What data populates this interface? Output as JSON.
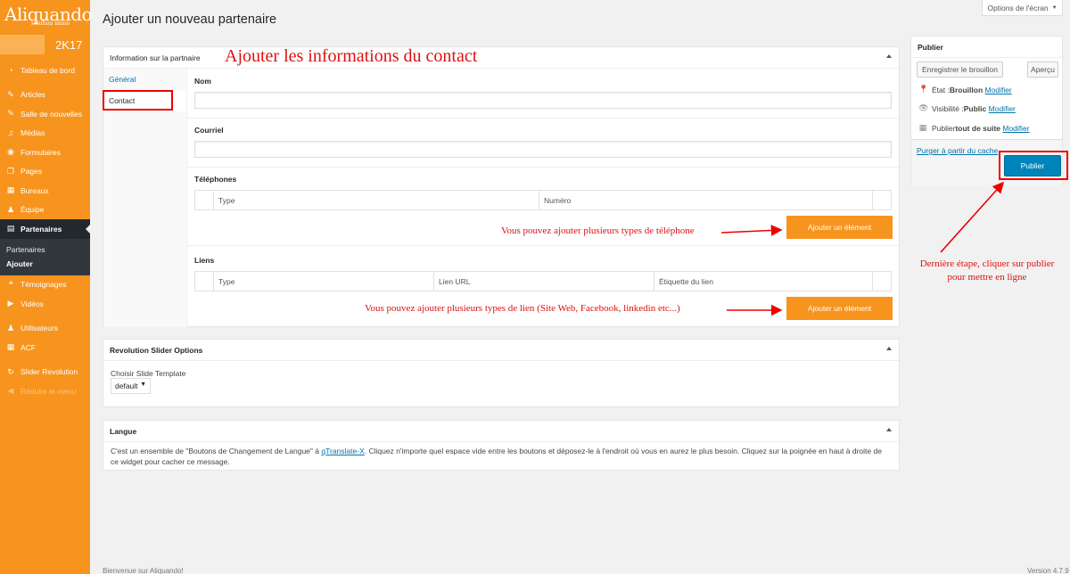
{
  "brand": {
    "logo_text": "Aliquando",
    "logo_sub": "solution immo",
    "year_badge": "2K17"
  },
  "sidebar": {
    "items": [
      {
        "label": "Tableau de bord",
        "icon": "dashboard-icon"
      },
      {
        "label": "Articles",
        "icon": "pin-icon"
      },
      {
        "label": "Salle de nouvelles",
        "icon": "pin-icon"
      },
      {
        "label": "Médias",
        "icon": "media-icon"
      },
      {
        "label": "Formulaires",
        "icon": "forms-icon"
      },
      {
        "label": "Pages",
        "icon": "pages-icon"
      },
      {
        "label": "Bureaux",
        "icon": "building-icon"
      },
      {
        "label": "Équipe",
        "icon": "team-icon"
      },
      {
        "label": "Partenaires",
        "icon": "id-card-icon"
      },
      {
        "label": "Témoignages",
        "icon": "quote-icon"
      },
      {
        "label": "Vidéos",
        "icon": "video-icon"
      },
      {
        "label": "Utilisateurs",
        "icon": "users-icon"
      },
      {
        "label": "ACF",
        "icon": "grid-icon"
      },
      {
        "label": "Slider Revolution",
        "icon": "refresh-icon"
      },
      {
        "label": "Réduire le menu",
        "icon": "collapse-icon"
      }
    ],
    "submenu": {
      "parent": "Partenaires",
      "items": [
        "Partenaires",
        "Ajouter"
      ]
    }
  },
  "header": {
    "title": "Ajouter un nouveau partenaire",
    "screen_options": "Options de l'écran"
  },
  "info_box": {
    "title": "Information sur la partnaire",
    "tabs": [
      "Général",
      "Contact"
    ],
    "nom_label": "Nom",
    "courriel_label": "Courriel",
    "telephones_label": "Téléphones",
    "telephones_columns": [
      "Type",
      "Numéro"
    ],
    "liens_label": "Liens",
    "liens_columns": [
      "Type",
      "Lien URL",
      "Étiquette du lien"
    ],
    "add_button": "Ajouter un élément"
  },
  "slider_box": {
    "title": "Revolution Slider Options",
    "label": "Choisir Slide Template",
    "selected": "default"
  },
  "langue_box": {
    "title": "Langue",
    "text_before": "C'est un ensemble de \"Boutons de Changement de Langue\" à ",
    "link": "qTranslate-X",
    "text_after": ". Cliquez n'importe quel espace vide entre les boutons et déposez-le à l'endroit où vous en aurez le plus besoin. Cliquez sur la poignée en haut à droite de ce widget pour cacher ce message."
  },
  "publish_box": {
    "title": "Publier",
    "save_draft": "Enregistrer le brouillon",
    "preview": "Aperçu",
    "status_label": "État : ",
    "status_value": "Brouillon",
    "visibility_label": "Visibilité : ",
    "visibility_value": "Public",
    "publish_label": "Publier ",
    "publish_value": "tout de suite",
    "modify": "Modifier",
    "purge_cache": "Purger à partir du cache",
    "publish_button": "Publier"
  },
  "annotations": {
    "heading": "Ajouter les informations du contact",
    "phone_note": "Vous pouvez ajouter plusieurs types de téléphone",
    "link_note": "Vous pouvez ajouter plusieurs types de lien (Site Web, Facebook, linkedin etc...)",
    "final_step": "Dernière étape, cliquer sur publier pour mettre en ligne",
    "color": "#dd1111"
  },
  "footer": {
    "left": "Bienvenue sur Aliquando!",
    "version": "Version 4.7.9"
  },
  "colors": {
    "sidebar": "#f7941d",
    "accent_blue": "#0085ba",
    "orange_button": "#f7941d"
  }
}
